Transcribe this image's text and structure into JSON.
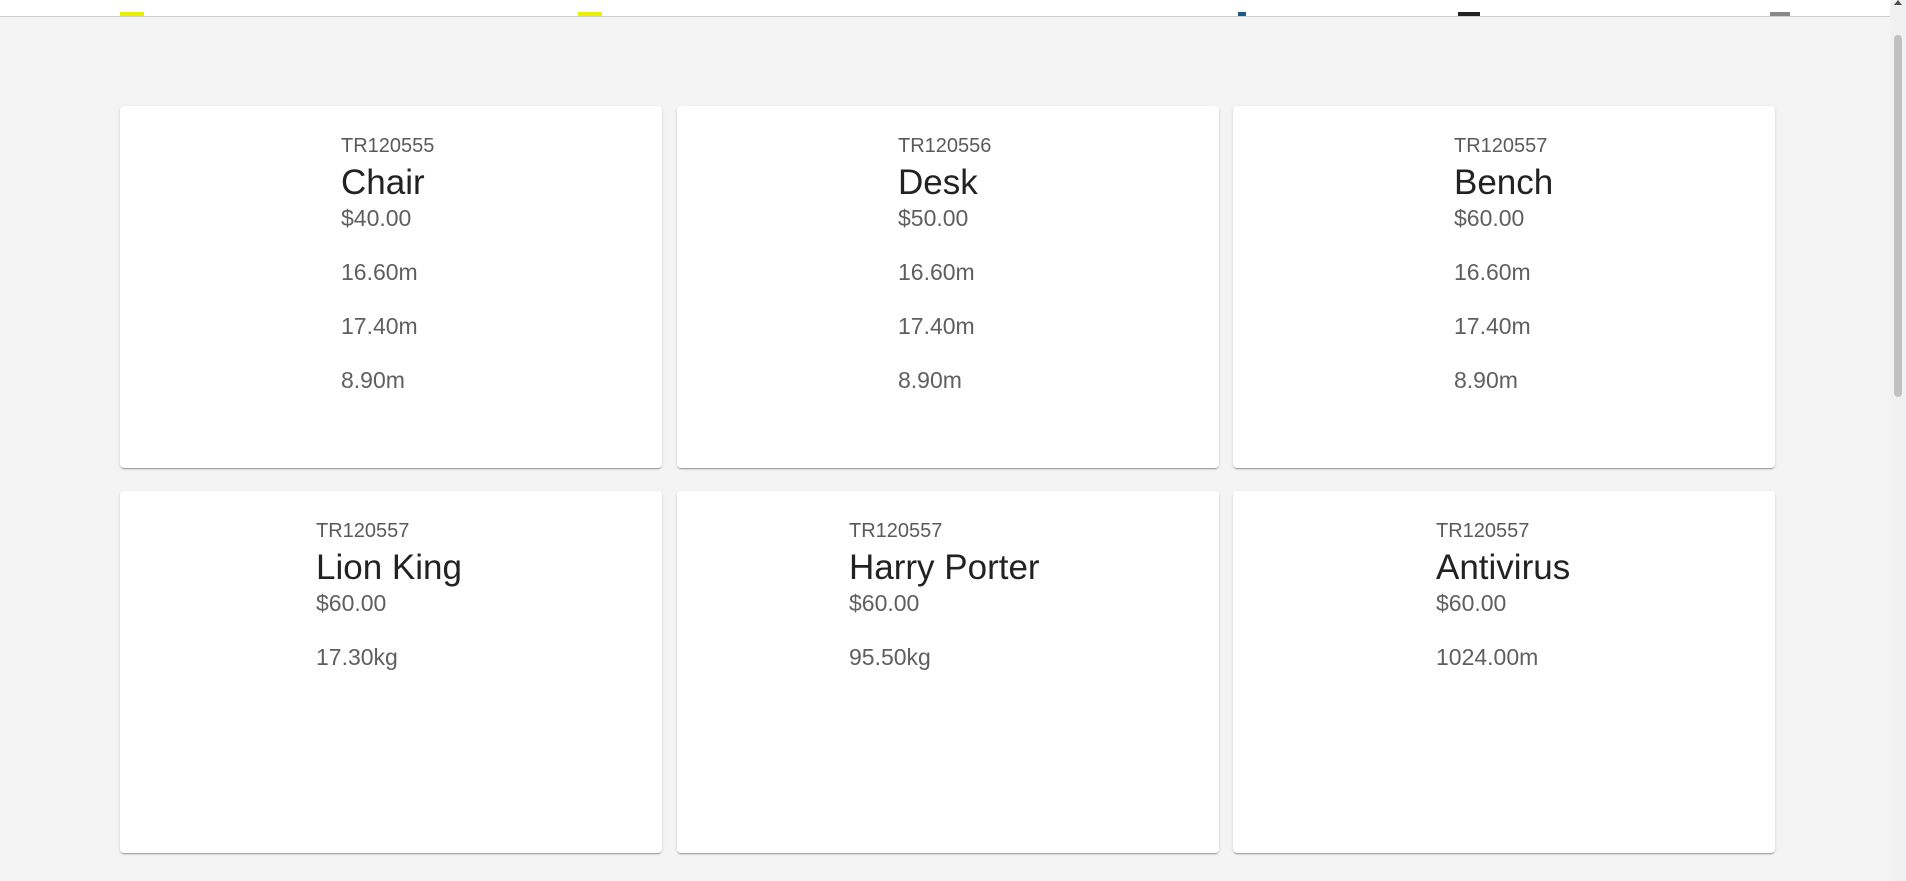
{
  "cards": [
    {
      "sku": "TR120555",
      "name": "Chair",
      "price": "$40.00",
      "measures": [
        "16.60m",
        "17.40m",
        "8.90m"
      ]
    },
    {
      "sku": "TR120556",
      "name": "Desk",
      "price": "$50.00",
      "measures": [
        "16.60m",
        "17.40m",
        "8.90m"
      ]
    },
    {
      "sku": "TR120557",
      "name": "Bench",
      "price": "$60.00",
      "measures": [
        "16.60m",
        "17.40m",
        "8.90m"
      ]
    },
    {
      "sku": "TR120557",
      "name": "Lion King",
      "price": "$60.00",
      "measures": [
        "17.30kg"
      ]
    },
    {
      "sku": "TR120557",
      "name": "Harry Porter",
      "price": "$60.00",
      "measures": [
        "95.50kg"
      ]
    },
    {
      "sku": "TR120557",
      "name": "Antivirus",
      "price": "$60.00",
      "measures": [
        "1024.00m"
      ]
    }
  ],
  "colors": {
    "background": "#f4f4f4",
    "card": "#ffffff",
    "accent": "#e8f000"
  }
}
